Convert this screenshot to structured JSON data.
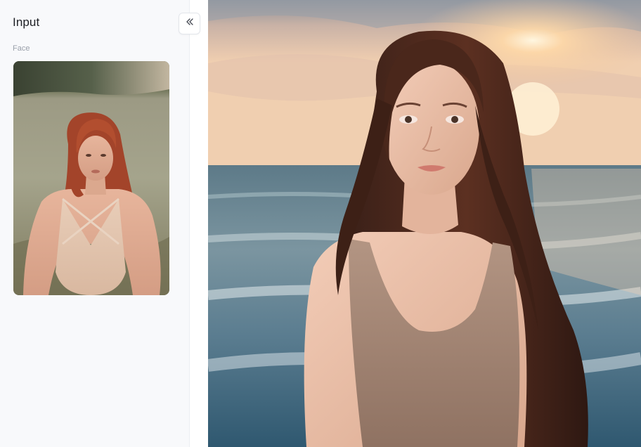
{
  "sidebar": {
    "title": "Input",
    "face_label": "Face",
    "collapse_icon": "double-chevron-left-icon"
  },
  "input_face": {
    "icon": "face-reference-thumbnail"
  },
  "result_image": {
    "icon": "generated-portrait"
  },
  "colors": {
    "sidebar_bg": "#f8f9fb",
    "title_text": "#1d1f24",
    "label_text": "#9aa0aa",
    "border": "#e3e6eb"
  }
}
